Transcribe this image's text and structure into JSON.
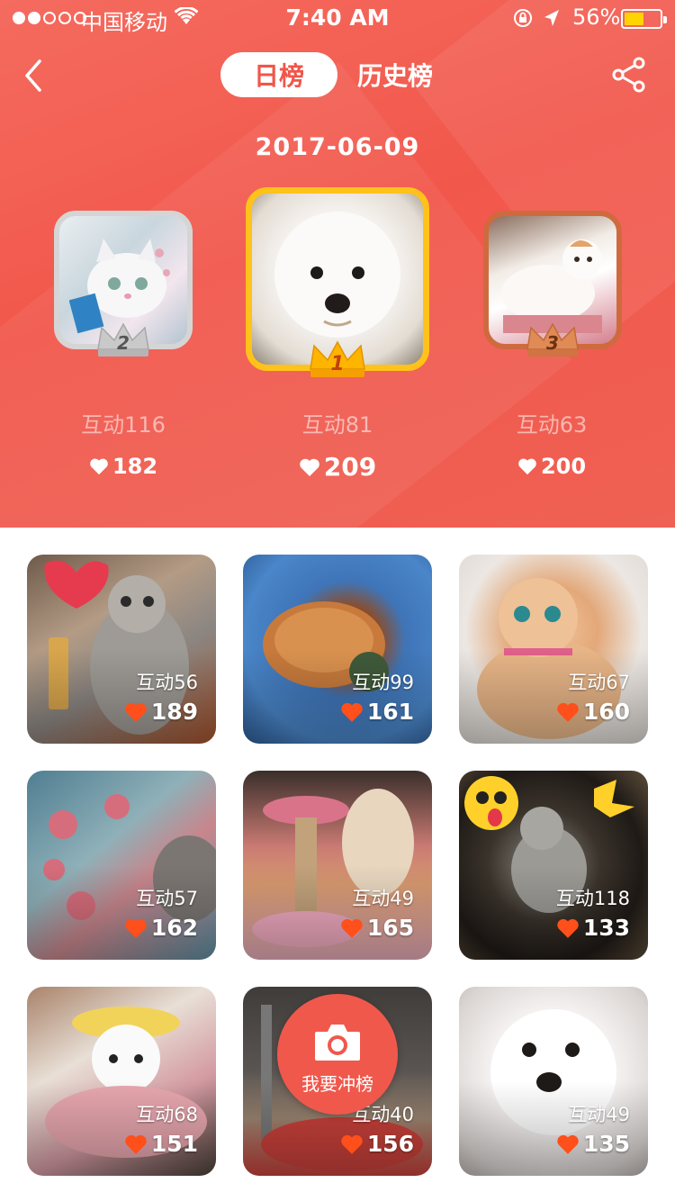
{
  "status_bar": {
    "carrier": "中国移动",
    "time": "7:40 AM",
    "battery_percent": "56%",
    "battery_level": 0.56,
    "signal_bars": 2
  },
  "nav": {
    "tab_daily": "日榜",
    "tab_history": "历史榜",
    "active_tab": "tab_daily"
  },
  "date": "2017-06-09",
  "podium": [
    {
      "rank": "2",
      "label": "互动116",
      "likes": "182",
      "crown_color": "#c9c9c9"
    },
    {
      "rank": "1",
      "label": "互动81",
      "likes": "209",
      "crown_color": "#ffb400"
    },
    {
      "rank": "3",
      "label": "互动63",
      "likes": "200",
      "crown_color": "#d97e4a"
    }
  ],
  "grid": [
    {
      "label": "互动56",
      "likes": "189"
    },
    {
      "label": "互动99",
      "likes": "161"
    },
    {
      "label": "互动67",
      "likes": "160"
    },
    {
      "label": "互动57",
      "likes": "162"
    },
    {
      "label": "互动49",
      "likes": "165"
    },
    {
      "label": "互动118",
      "likes": "133"
    },
    {
      "label": "互动68",
      "likes": "151"
    },
    {
      "label": "互动40",
      "likes": "156"
    },
    {
      "label": "互动49",
      "likes": "135"
    }
  ],
  "fab": {
    "label": "我要冲榜",
    "icon": "camera-icon"
  },
  "colors": {
    "brand": "#f0564a",
    "heart": "#ff4f1a",
    "gold": "#ffc21a"
  }
}
